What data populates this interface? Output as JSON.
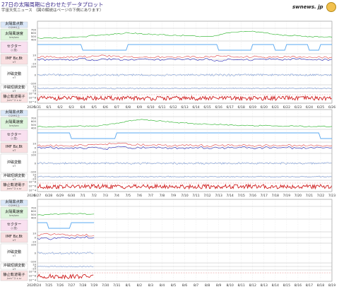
{
  "header": {
    "title": "27日の太陽周期に合わせたデータプロット",
    "subtitle": "宇宙天気ニュース （図の解説はページの下側にあります）",
    "logo_text": "swnews. jp"
  },
  "panel_labels": [
    {
      "key": "sunspots",
      "text": "太陽黒点数",
      "sub": "CI2MG上",
      "bg": "#dbe8f9"
    },
    {
      "key": "wind",
      "text": "太陽風速度",
      "sub": "km/sec",
      "bg": "#dff5dd"
    },
    {
      "key": "sector",
      "text": "セクター",
      "sub": "(/ 度)",
      "bg": "#f9e0f0"
    },
    {
      "key": "imf",
      "text": "IMF Bz,Bt",
      "sub": "nT",
      "bg": "#f9dfe1"
    },
    {
      "key": "xray",
      "text": "沖磁変動",
      "sub": "nT",
      "bg": "#ffffff"
    },
    {
      "key": "xray2",
      "text": "沖磁短期変動",
      "sub": "nT",
      "bg": "#ffffff"
    },
    {
      "key": "electron",
      "text": "静止軌道電子",
      "sub": "/cm^2 s sr",
      "bg": "#fbe3e3"
    }
  ],
  "axis_ticks": {
    "wind": [
      "700",
      "600",
      "500",
      "400"
    ],
    "imf": [
      "10",
      "0",
      "-10"
    ],
    "xray": [
      "100",
      "0",
      "-100"
    ],
    "xray2": [
      "10",
      "0",
      "-10"
    ],
    "electron": [
      "10^8",
      "10^6",
      "10^4"
    ]
  },
  "chart_data": [
    {
      "type": "line",
      "period": 1,
      "year_label": "2020",
      "x_ticks": [
        "5/31",
        "6/1",
        "6/2",
        "6/3",
        "6/4",
        "6/5",
        "6/6",
        "6/7",
        "6/8",
        "6/9",
        "6/10",
        "6/11",
        "6/12",
        "6/13",
        "6/14",
        "6/15",
        "6/16",
        "6/17",
        "6/18",
        "6/19",
        "6/20",
        "6/21",
        "6/22",
        "6/23",
        "6/24",
        "6/25",
        "6/26"
      ],
      "series": [
        {
          "key": "wind_speed",
          "color": "#22b022",
          "values": [
            400,
            395,
            390,
            420,
            430,
            480,
            500,
            520,
            560,
            530,
            510,
            500,
            480,
            470,
            450,
            440,
            480,
            560,
            600,
            610,
            560,
            500,
            480,
            460,
            440,
            430,
            420
          ]
        },
        {
          "key": "sector",
          "color": "#5aa8f0",
          "values": [
            1,
            1,
            1,
            1,
            -1,
            -1,
            -1,
            -1,
            1,
            1,
            1,
            1,
            1,
            1,
            1,
            1,
            -1,
            -1,
            -1,
            1,
            1,
            -1,
            1,
            1,
            -1,
            1,
            1
          ]
        },
        {
          "key": "imf_bt",
          "color": "#e04040",
          "values": [
            5,
            6,
            5,
            7,
            6,
            8,
            9,
            7,
            6,
            5,
            5,
            6,
            5,
            6,
            5,
            7,
            9,
            8,
            6,
            6,
            5,
            5,
            6,
            5,
            6,
            5,
            5
          ]
        },
        {
          "key": "imf_bz",
          "color": "#2a2ab8",
          "values": [
            0,
            -2,
            1,
            -1,
            2,
            -3,
            1,
            0,
            -2,
            1,
            0,
            -1,
            1,
            0,
            -1,
            2,
            -4,
            1,
            0,
            -2,
            1,
            0,
            -1,
            1,
            0,
            -1,
            0
          ]
        }
      ]
    },
    {
      "type": "line",
      "period": 2,
      "year_label": "2020",
      "x_ticks": [
        "6/27",
        "6/28",
        "6/29",
        "6/30",
        "7/1",
        "7/2",
        "7/3",
        "7/4",
        "7/5",
        "7/6",
        "7/7",
        "7/8",
        "7/9",
        "7/10",
        "7/11",
        "7/12",
        "7/13",
        "7/14",
        "7/15",
        "7/16",
        "7/17",
        "7/18",
        "7/19",
        "7/20",
        "7/21",
        "7/22",
        "7/23"
      ],
      "series": [
        {
          "key": "wind_speed",
          "color": "#22b022",
          "values": [
            380,
            385,
            390,
            395,
            400,
            410,
            440,
            500,
            560,
            600,
            590,
            560,
            520,
            500,
            480,
            460,
            450,
            440,
            430,
            420,
            420,
            410,
            400,
            400,
            395,
            390,
            390
          ]
        },
        {
          "key": "sector",
          "color": "#5aa8f0",
          "values": [
            1,
            1,
            1,
            -1,
            -1,
            -1,
            -1,
            1,
            1,
            1,
            1,
            1,
            1,
            1,
            1,
            1,
            1,
            1,
            1,
            1,
            1,
            1,
            1,
            1,
            1,
            -1,
            -1
          ]
        },
        {
          "key": "imf_bt",
          "color": "#e04040",
          "values": [
            5,
            5,
            6,
            5,
            6,
            7,
            9,
            10,
            8,
            7,
            6,
            6,
            5,
            5,
            6,
            5,
            5,
            6,
            5,
            5,
            5,
            6,
            5,
            5,
            6,
            5,
            5
          ]
        },
        {
          "key": "imf_bz",
          "color": "#2a2ab8",
          "values": [
            0,
            1,
            -1,
            0,
            -2,
            1,
            -3,
            2,
            -1,
            0,
            1,
            -1,
            0,
            -3,
            1,
            0,
            -1,
            0,
            1,
            -1,
            0,
            1,
            0,
            -1,
            0,
            1,
            0
          ]
        }
      ]
    },
    {
      "type": "line",
      "period": 3,
      "year_label": "2020",
      "x_ticks": [
        "7/24",
        "7/25",
        "7/26",
        "7/27",
        "7/28",
        "7/29",
        "7/30",
        "7/31",
        "8/1",
        "8/2",
        "8/3",
        "8/4",
        "8/5",
        "8/6",
        "8/7",
        "8/8",
        "8/9",
        "8/10",
        "8/11",
        "8/12",
        "8/13",
        "8/14",
        "8/15",
        "8/16",
        "8/17",
        "8/18",
        "8/19"
      ],
      "series": [
        {
          "key": "wind_speed",
          "color": "#22b022",
          "values": [
            430,
            440,
            460,
            470,
            465,
            460
          ]
        },
        {
          "key": "sector",
          "color": "#5aa8f0",
          "values": [
            1,
            -1,
            -1,
            1,
            1,
            1
          ]
        },
        {
          "key": "imf_bt",
          "color": "#e04040",
          "values": [
            6,
            8,
            7,
            6,
            6,
            5
          ]
        },
        {
          "key": "imf_bz",
          "color": "#2a2ab8",
          "values": [
            -2,
            -4,
            -1,
            0,
            1,
            0
          ]
        }
      ]
    }
  ]
}
